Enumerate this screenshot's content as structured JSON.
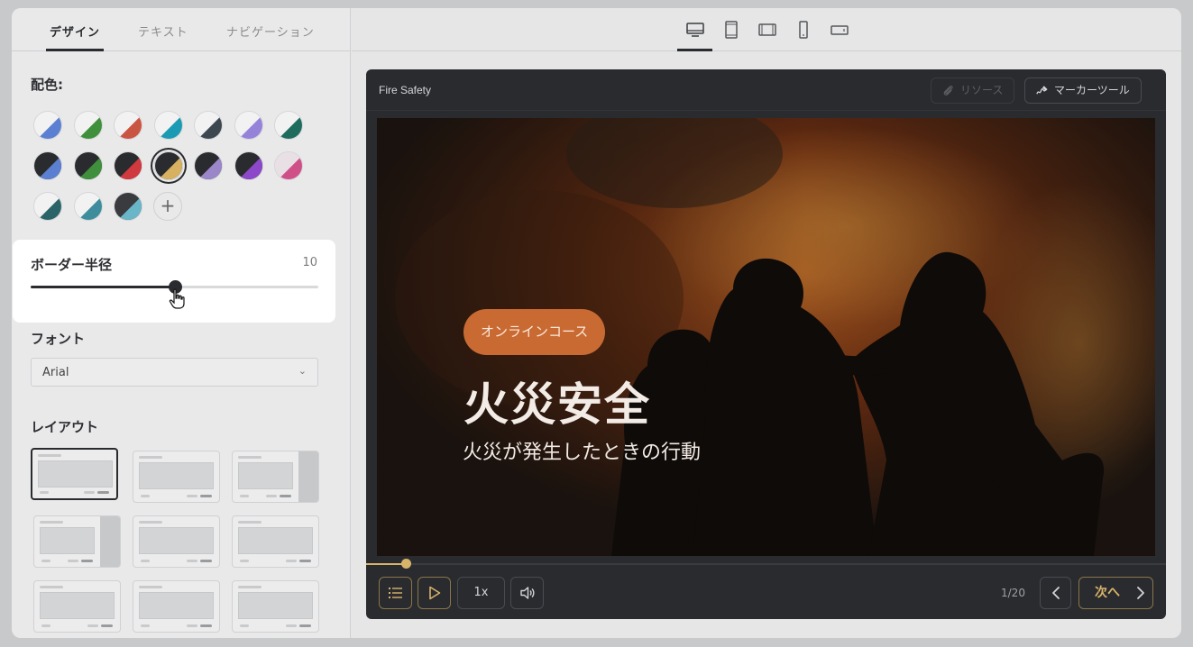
{
  "tabs": [
    {
      "label": "デザイン",
      "active": true
    },
    {
      "label": "テキスト",
      "active": false
    },
    {
      "label": "ナビゲーション",
      "active": false
    }
  ],
  "colors_section": {
    "label": "配色:",
    "swatches": [
      {
        "a": "#f2f2f3",
        "b": "#5b7fd1"
      },
      {
        "a": "#f2f2f3",
        "b": "#3f8f3c"
      },
      {
        "a": "#f2f2f3",
        "b": "#c95442"
      },
      {
        "a": "#f2f2f3",
        "b": "#1b9bb3"
      },
      {
        "a": "#f2f2f3",
        "b": "#3c4750"
      },
      {
        "a": "#f2f2f3",
        "b": "#9583d9"
      },
      {
        "a": "#f2f2f3",
        "b": "#1f6b5d"
      },
      {
        "a": "#2a2b2e",
        "b": "#5b7fd1"
      },
      {
        "a": "#2a2b2e",
        "b": "#3f8f3c"
      },
      {
        "a": "#2a2b2e",
        "b": "#d0393e"
      },
      {
        "a": "#2a2b2e",
        "b": "#d7b060",
        "selected": true
      },
      {
        "a": "#2a2b2e",
        "b": "#9a86c9"
      },
      {
        "a": "#2a2b2e",
        "b": "#8c48c9"
      },
      {
        "a": "#e9e0e5",
        "b": "#cf4f88"
      },
      {
        "a": "#f2f2f3",
        "b": "#2b6468"
      },
      {
        "a": "#f2f2f3",
        "b": "#3d8d9c"
      },
      {
        "a": "#3a3b3f",
        "b": "#69b6c8"
      }
    ],
    "add_label": "+"
  },
  "border_radius": {
    "label": "ボーダー半径",
    "value": "10",
    "fraction": 0.5
  },
  "font_section": {
    "label": "フォント",
    "selected": "Arial"
  },
  "layout_section": {
    "label": "レイアウト"
  },
  "devices": [
    "desktop-icon",
    "tablet-portrait-icon",
    "tablet-landscape-icon",
    "phone-portrait-icon",
    "phone-landscape-icon"
  ],
  "player": {
    "course_title": "Fire Safety",
    "resources_label": "リソース",
    "marker_label": "マーカーツール",
    "pill": "オンラインコース",
    "title": "火災安全",
    "subtitle": "火災が発生したときの行動",
    "progress": 0.05,
    "speed": "1x",
    "counter": "1/20",
    "next_label": "次へ",
    "accent": "#d8b36a"
  }
}
